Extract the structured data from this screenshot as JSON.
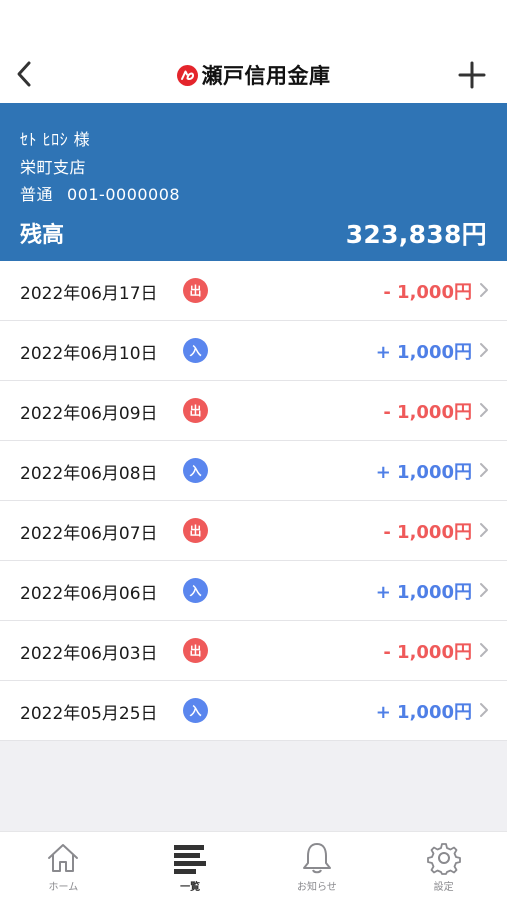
{
  "header": {
    "back_icon": "chevron-left-icon",
    "logo_icon": "shinkin-logo-icon",
    "brand_name": "瀬戸信用金庫",
    "add_icon": "plus-icon"
  },
  "account": {
    "holder": "ｾﾄ ﾋﾛｼ 様",
    "branch": "栄町支店",
    "type": "普通",
    "number": "001-0000008",
    "balance_label": "残高",
    "balance": "323,838円",
    "background_color": "#2f74b5"
  },
  "transactions": [
    {
      "date": "2022年06月17日",
      "kind": "出",
      "amount": "- 1,000円"
    },
    {
      "date": "2022年06月10日",
      "kind": "入",
      "amount": "+ 1,000円"
    },
    {
      "date": "2022年06月09日",
      "kind": "出",
      "amount": "- 1,000円"
    },
    {
      "date": "2022年06月08日",
      "kind": "入",
      "amount": "+ 1,000円"
    },
    {
      "date": "2022年06月07日",
      "kind": "出",
      "amount": "- 1,000円"
    },
    {
      "date": "2022年06月06日",
      "kind": "入",
      "amount": "+ 1,000円"
    },
    {
      "date": "2022年06月03日",
      "kind": "出",
      "amount": "- 1,000円"
    },
    {
      "date": "2022年05月25日",
      "kind": "入",
      "amount": "+ 1,000円"
    }
  ],
  "colors": {
    "withdrawal": "#ef5a5a",
    "deposit": "#4f7fe6"
  },
  "tabs": [
    {
      "label": "ホーム",
      "icon": "home-icon"
    },
    {
      "label": "一覧",
      "icon": "list-icon",
      "active": true
    },
    {
      "label": "お知らせ",
      "icon": "bell-icon"
    },
    {
      "label": "設定",
      "icon": "gear-icon"
    }
  ]
}
